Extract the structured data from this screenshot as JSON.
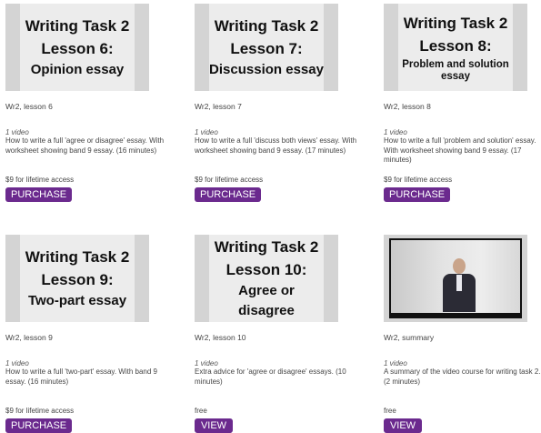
{
  "cards": [
    {
      "title_line1": "Writing Task 2",
      "title_line2": "Lesson 6:",
      "title_line3": "Opinion essay",
      "code": "Wr2, lesson 6",
      "count": "1 video",
      "description": "How to write a full 'agree or disagree' essay. With worksheet showing band 9 essay. (16 minutes)",
      "price": "$9 for lifetime access",
      "button": "PURCHASE"
    },
    {
      "title_line1": "Writing Task 2",
      "title_line2": "Lesson 7:",
      "title_line3": "Discussion essay",
      "code": "Wr2, lesson 7",
      "count": "1 video",
      "description": "How to write a full 'discuss both views' essay. With worksheet showing band 9 essay. (17 minutes)",
      "price": "$9 for lifetime access",
      "button": "PURCHASE"
    },
    {
      "title_line1": "Writing Task 2",
      "title_line2": "Lesson 8:",
      "title_line3": "Problem and solution essay",
      "code": "Wr2, lesson 8",
      "count": "1 video",
      "description": "How to write a full 'problem and solution' essay. With worksheet showing band 9 essay. (17 minutes)",
      "price": "$9 for lifetime access",
      "button": "PURCHASE"
    },
    {
      "title_line1": "Writing Task 2",
      "title_line2": "Lesson 9:",
      "title_line3": "Two-part essay",
      "code": "Wr2, lesson 9",
      "count": "1 video",
      "description": "How to write a full 'two-part' essay. With band 9 essay. (16 minutes)",
      "price": "$9 for lifetime access",
      "button": "PURCHASE"
    },
    {
      "title_line1": "Writing Task 2",
      "title_line2": "Lesson 10:",
      "title_line3": "Agree or disagree",
      "code": "Wr2, lesson 10",
      "count": "1 video",
      "description": "Extra advice for 'agree or disagree' essays. (10 minutes)",
      "price": "free",
      "button": "VIEW"
    },
    {
      "code": "Wr2, summary",
      "count": "1 video",
      "description": "A summary of the video course for writing task 2. (2 minutes)",
      "price": "free",
      "button": "VIEW"
    }
  ],
  "colors": {
    "button_bg": "#6b2a8e",
    "thumb_border": "#d4d4d4",
    "thumb_inner": "#ececec"
  },
  "icons": {
    "video_thumbnail": "presenter-video-icon"
  }
}
